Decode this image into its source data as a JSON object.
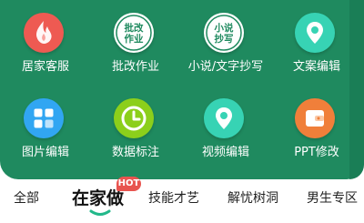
{
  "grid": {
    "items": [
      {
        "label": "居家客服",
        "icon": "flame-icon",
        "color": "#ee5a52"
      },
      {
        "label": "批改作业",
        "icon": "stamp-icon",
        "icon_text": [
          "批改",
          "作业"
        ],
        "color": "#ffffff"
      },
      {
        "label": "小说/文字抄写",
        "icon": "stamp-icon",
        "icon_text": [
          "小说",
          "抄写"
        ],
        "color": "#ffffff"
      },
      {
        "label": "文案编辑",
        "icon": "location-pin-icon",
        "color": "#37d3b4"
      },
      {
        "label": "图片编辑",
        "icon": "grid-icon",
        "color": "#31a6f2"
      },
      {
        "label": "数据标注",
        "icon": "clock-icon",
        "color": "#8ccf1b"
      },
      {
        "label": "视频编辑",
        "icon": "location-pin-icon",
        "color": "#37d3b4"
      },
      {
        "label": "PPT修改",
        "icon": "wallet-icon",
        "color": "#f07f3a"
      }
    ]
  },
  "tabs": {
    "items": [
      "全部",
      "在家做",
      "技能才艺",
      "解忧树洞",
      "男生专区"
    ],
    "active": "在家做",
    "badge": "HOT"
  },
  "colors": {
    "panel": "#1f8a5f",
    "badge": "#e8544f",
    "accent": "#22b88a"
  }
}
